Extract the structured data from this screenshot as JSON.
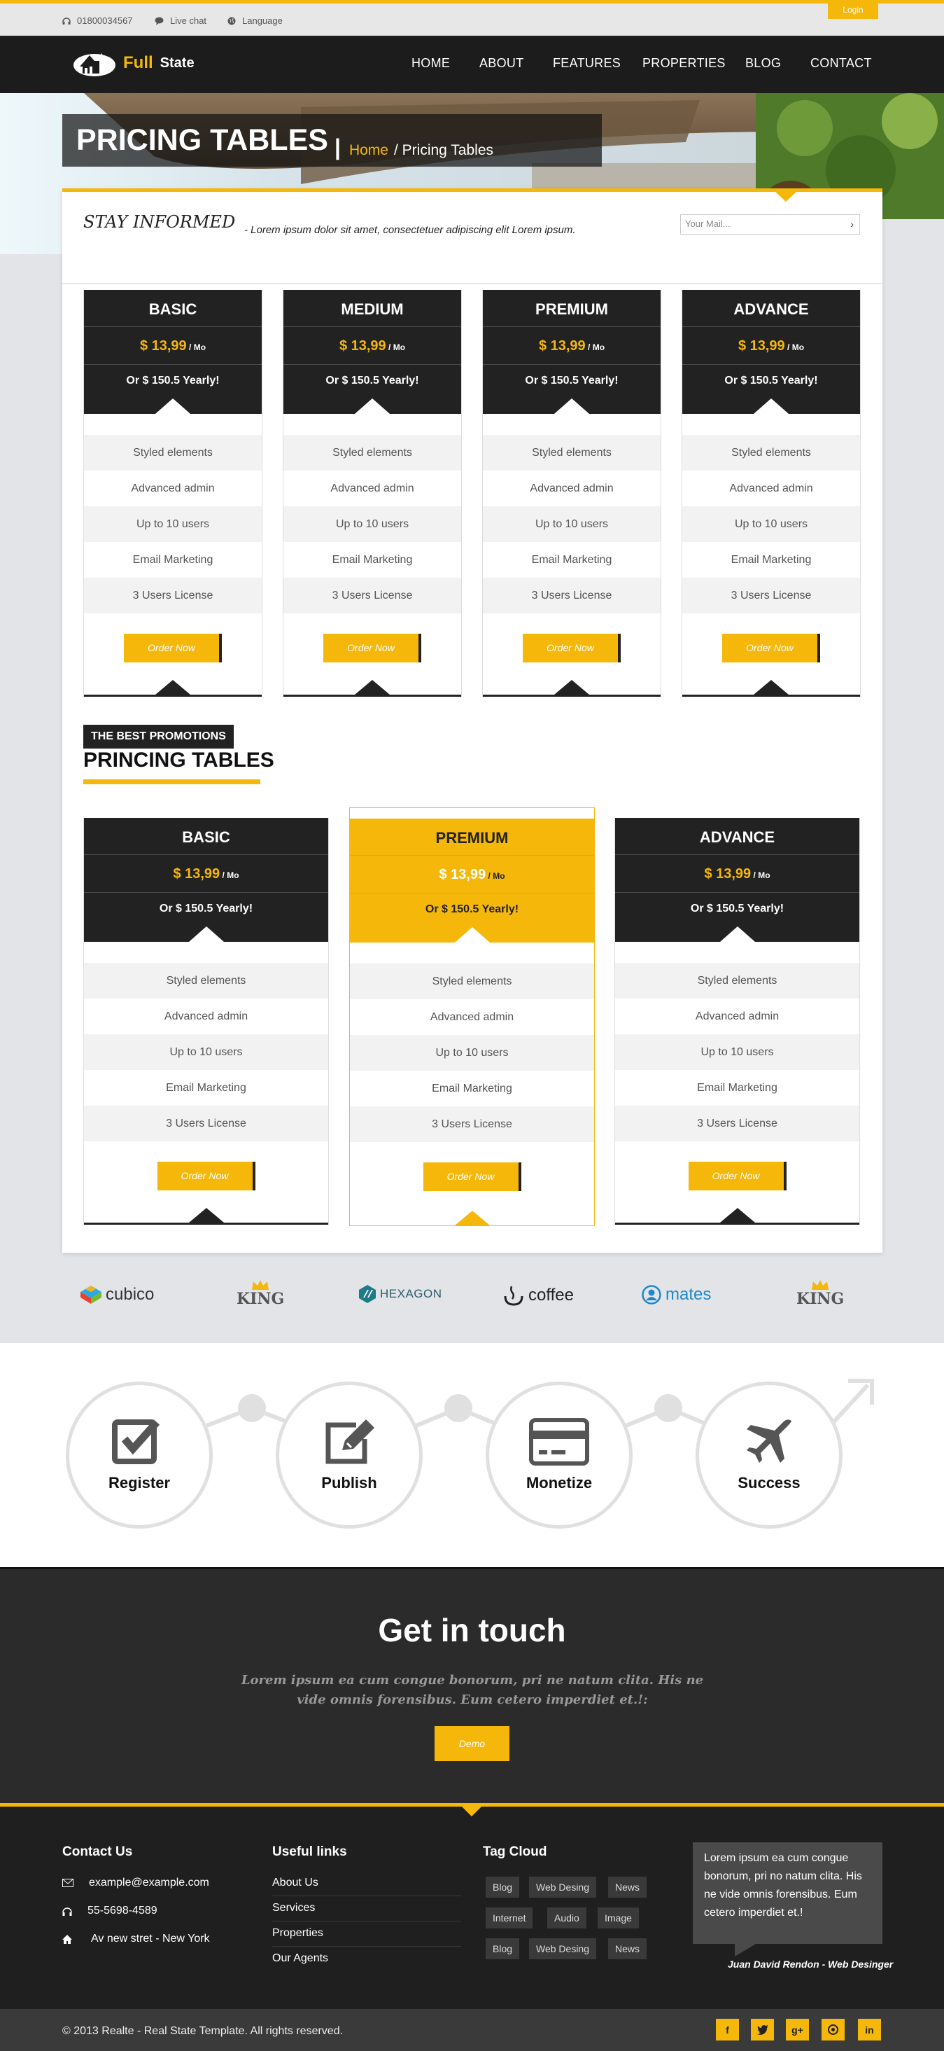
{
  "topbar": {
    "phone": "01800034567",
    "chat": "Live chat",
    "language": "Language",
    "login": "Login"
  },
  "logo": {
    "word1": "Full",
    "word2": "State"
  },
  "nav": [
    "HOME",
    "ABOUT",
    "FEATURES",
    "PROPERTIES",
    "BLOG",
    "CONTACT"
  ],
  "hero": {
    "title": "PRICING TABLES",
    "crumb_sep": "|",
    "crumb_home": "Home",
    "crumb_current": "/ Pricing Tables"
  },
  "stay": {
    "title": "STAY INFORMED",
    "text": "- Lorem ipsum dolor sit amet, consectetuer adipiscing elit Lorem ipsum.",
    "placeholder": "Your Mail...",
    "arrow": "›"
  },
  "pricing1": [
    {
      "name": "BASIC",
      "price": "$ 13,99",
      "per": "/ Mo",
      "yearly": "Or $ 150.5 Yearly!"
    },
    {
      "name": "MEDIUM",
      "price": "$ 13,99",
      "per": "/ Mo",
      "yearly": "Or $ 150.5 Yearly!"
    },
    {
      "name": "PREMIUM",
      "price": "$ 13,99",
      "per": "/ Mo",
      "yearly": "Or $ 150.5 Yearly!"
    },
    {
      "name": "ADVANCE",
      "price": "$ 13,99",
      "per": "/ Mo",
      "yearly": "Or $ 150.5 Yearly!"
    }
  ],
  "features": [
    "Styled elements",
    "Advanced admin",
    "Up to 10 users",
    "Email Marketing",
    "3 Users License"
  ],
  "order_label": "Order Now",
  "promo": {
    "tag": "THE BEST PROMOTIONS",
    "title": "PRINCING TABLES"
  },
  "pricing2": [
    {
      "name": "BASIC",
      "price": "$ 13,99",
      "per": "/ Mo",
      "yearly": "Or $ 150.5 Yearly!"
    },
    {
      "name": "PREMIUM",
      "price": "$ 13,99",
      "per": "/ Mo",
      "yearly": "Or $ 150.5 Yearly!"
    },
    {
      "name": "ADVANCE",
      "price": "$ 13,99",
      "per": "/ Mo",
      "yearly": "Or $ 150.5 Yearly!"
    }
  ],
  "brands": [
    "cubico",
    "KING",
    "HEXAGON",
    "coffee",
    "mates",
    "KING"
  ],
  "steps": [
    "Register",
    "Publish",
    "Monetize",
    "Success"
  ],
  "touch": {
    "title": "Get in touch",
    "text": "Lorem ipsum ea cum congue bonorum, pri ne natum clita. His ne vide omnis forensibus. Eum cetero imperdiet et.!:",
    "button": "Demo"
  },
  "footer": {
    "contact_title": "Contact Us",
    "email": "example@example.com",
    "phone": "55-5698-4589",
    "address": "Av new stret - New York",
    "links_title": "Useful links",
    "links": [
      "About Us",
      "Services",
      "Properties",
      "Our Agents"
    ],
    "tags_title": "Tag Cloud",
    "tags": [
      "Blog",
      "Web Desing",
      "News",
      "Internet",
      "Audio",
      "Image",
      "Blog",
      "Web Desing",
      "News"
    ],
    "quote": "Lorem ipsum ea cum congue bonorum, pri no natum clita. His ne vide omnis forensibus. Eum cetero imperdiet et.!",
    "signature": "Juan David Rendon - Web Desinger",
    "copyright": "© 2013 Realte - Real State Template. All rights reserved.",
    "social": [
      "f",
      "t",
      "g+",
      "p",
      "in"
    ]
  },
  "colors": {
    "accent": "#f4b70a",
    "dark": "#222222"
  }
}
